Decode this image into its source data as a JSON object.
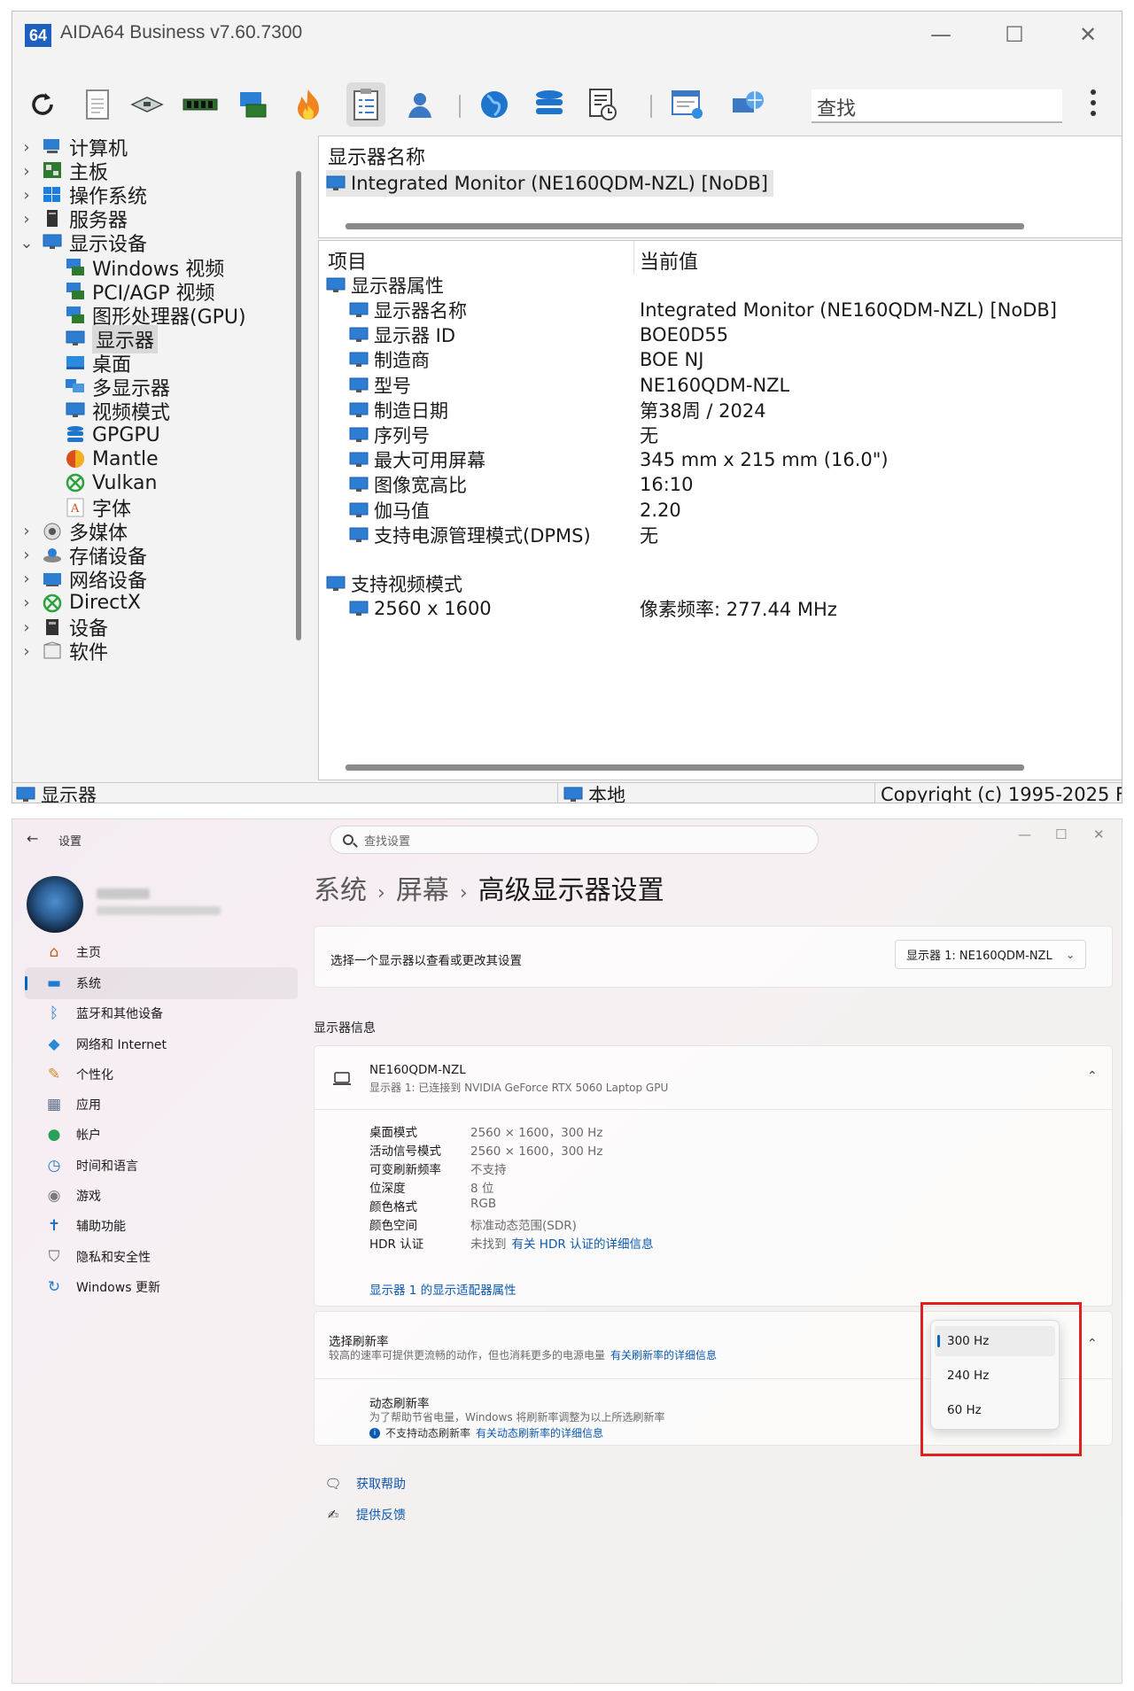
{
  "aida": {
    "logo": "64",
    "title": "AIDA64 Business v7.60.7300",
    "controls": {
      "minimize": "—",
      "maximize": "☐",
      "close": "✕"
    },
    "search_placeholder": "查找",
    "tree": [
      {
        "label": "计算机",
        "chev": "›",
        "icon": "computer-icon"
      },
      {
        "label": "主板",
        "chev": "›",
        "icon": "motherboard-icon"
      },
      {
        "label": "操作系统",
        "chev": "›",
        "icon": "windows-icon"
      },
      {
        "label": "服务器",
        "chev": "›",
        "icon": "server-icon"
      },
      {
        "label": "显示设备",
        "chev": "⌄",
        "icon": "display-icon"
      },
      {
        "label": "Windows 视频",
        "icon": "monitor-card-icon"
      },
      {
        "label": "PCI/AGP 视频",
        "icon": "monitor-card-icon"
      },
      {
        "label": "图形处理器(GPU)",
        "icon": "monitor-card-icon"
      },
      {
        "label": "显示器",
        "icon": "monitor-icon"
      },
      {
        "label": "桌面",
        "icon": "desktop-icon"
      },
      {
        "label": "多显示器",
        "icon": "multi-monitor-icon"
      },
      {
        "label": "视频模式",
        "icon": "monitor-icon"
      },
      {
        "label": "GPGPU",
        "icon": "database-icon"
      },
      {
        "label": "Mantle",
        "icon": "mantle-icon"
      },
      {
        "label": "Vulkan",
        "icon": "vulkan-icon"
      },
      {
        "label": "字体",
        "icon": "font-icon"
      },
      {
        "label": "多媒体",
        "chev": "›",
        "icon": "speaker-icon"
      },
      {
        "label": "存储设备",
        "chev": "›",
        "icon": "storage-icon"
      },
      {
        "label": "网络设备",
        "chev": "›",
        "icon": "network-icon"
      },
      {
        "label": "DirectX",
        "chev": "›",
        "icon": "xbox-icon"
      },
      {
        "label": "设备",
        "chev": "›",
        "icon": "device-icon"
      },
      {
        "label": "软件",
        "chev": "›",
        "icon": "software-icon"
      }
    ],
    "top_panel": {
      "header": "显示器名称",
      "monitor": "Integrated Monitor (NE160QDM-NZL) [NoDB]"
    },
    "columns": {
      "item": "项目",
      "value": "当前值"
    },
    "group1": "显示器属性",
    "props": [
      {
        "k": "显示器名称",
        "v": "Integrated Monitor (NE160QDM-NZL) [NoDB]"
      },
      {
        "k": "显示器 ID",
        "v": "BOE0D55"
      },
      {
        "k": "制造商",
        "v": "BOE NJ"
      },
      {
        "k": "型号",
        "v": "NE160QDM-NZL"
      },
      {
        "k": "制造日期",
        "v": "第38周 / 2024"
      },
      {
        "k": "序列号",
        "v": "无"
      },
      {
        "k": "最大可用屏幕",
        "v": "345 mm x 215 mm (16.0\")"
      },
      {
        "k": "图像宽高比",
        "v": "16:10"
      },
      {
        "k": "伽马值",
        "v": "2.20"
      },
      {
        "k": "支持电源管理模式(DPMS)",
        "v": "无"
      }
    ],
    "group2": "支持视频模式",
    "modes": [
      {
        "k": "2560 x 1600",
        "v": "像素频率: 277.44 MHz"
      }
    ],
    "status": {
      "left": "显示器",
      "mid": "本地",
      "right": "Copyright (c) 1995-2025 F"
    }
  },
  "settings": {
    "back": "←",
    "app_title": "设置",
    "search_placeholder": "查找设置",
    "controls": {
      "minimize": "—",
      "maximize": "☐",
      "close": "✕"
    },
    "nav": [
      {
        "label": "主页",
        "icon": "home-icon",
        "glyph": "⌂",
        "color": "#c0601c"
      },
      {
        "label": "系统",
        "icon": "system-icon",
        "glyph": "▬",
        "color": "#1e7bd2"
      },
      {
        "label": "蓝牙和其他设备",
        "icon": "bluetooth-icon",
        "glyph": "ᛒ",
        "color": "#1e7bd2"
      },
      {
        "label": "网络和 Internet",
        "icon": "wifi-icon",
        "glyph": "◆",
        "color": "#2a89d8"
      },
      {
        "label": "个性化",
        "icon": "brush-icon",
        "glyph": "✎",
        "color": "#d08a2a"
      },
      {
        "label": "应用",
        "icon": "apps-icon",
        "glyph": "▦",
        "color": "#5a6c85"
      },
      {
        "label": "帐户",
        "icon": "account-icon",
        "glyph": "●",
        "color": "#2aa05a"
      },
      {
        "label": "时间和语言",
        "icon": "clock-icon",
        "glyph": "◷",
        "color": "#1e7bd2"
      },
      {
        "label": "游戏",
        "icon": "gamepad-icon",
        "glyph": "◉",
        "color": "#7a7a7a"
      },
      {
        "label": "辅助功能",
        "icon": "accessibility-icon",
        "glyph": "✝",
        "color": "#1e6fc0"
      },
      {
        "label": "隐私和安全性",
        "icon": "shield-icon",
        "glyph": "⛉",
        "color": "#666666"
      },
      {
        "label": "Windows 更新",
        "icon": "update-icon",
        "glyph": "↻",
        "color": "#1e7bd2"
      }
    ],
    "breadcrumb": {
      "a": "系统",
      "b": "屏幕",
      "c": "高级显示器设置",
      "sep": "›"
    },
    "choose_display": {
      "label": "选择一个显示器以查看或更改其设置",
      "selected": "显示器 1: NE160QDM-NZL",
      "chev": "⌄"
    },
    "section_title": "显示器信息",
    "monitor": {
      "name": "NE160QDM-NZL",
      "sub": "显示器 1: 已连接到 NVIDIA GeForce RTX 5060 Laptop GPU",
      "chev": "⌃"
    },
    "info": [
      {
        "k": "桌面模式",
        "v": "2560 × 1600，300 Hz"
      },
      {
        "k": "活动信号模式",
        "v": "2560 × 1600，300 Hz"
      },
      {
        "k": "可变刷新频率",
        "v": "不支持"
      },
      {
        "k": "位深度",
        "v": "8 位"
      },
      {
        "k": "颜色格式",
        "v": "RGB"
      },
      {
        "k": "颜色空间",
        "v": "标准动态范围(SDR)"
      },
      {
        "k": "HDR 认证",
        "v": "未找到",
        "link": "有关 HDR 认证的详细信息"
      }
    ],
    "adapter_link": "显示器 1 的显示适配器属性",
    "refresh": {
      "title": "选择刷新率",
      "desc": "较高的速率可提供更流畅的动作，但也消耗更多的电源电量",
      "link": "有关刷新率的详细信息",
      "chev": "⌃"
    },
    "dynamic": {
      "title": "动态刷新率",
      "desc": "为了帮助节省电量，Windows 将刷新率调整为以上所选刷新率",
      "note": "不支持动态刷新率",
      "link": "有关动态刷新率的详细信息"
    },
    "dropdown": {
      "options": [
        "300 Hz",
        "240 Hz",
        "60 Hz"
      ],
      "selected": "300 Hz"
    },
    "help": {
      "get_help": "获取帮助",
      "feedback": "提供反馈"
    }
  }
}
